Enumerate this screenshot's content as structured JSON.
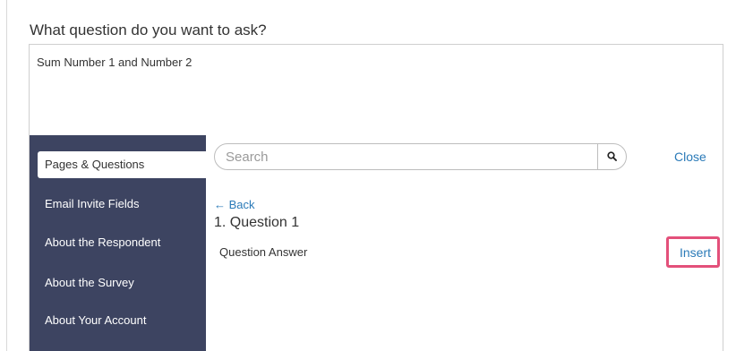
{
  "question": {
    "label": "What question do you want to ask?",
    "text": "Sum Number 1 and Number 2"
  },
  "sidebar": {
    "items": [
      {
        "label": "Pages & Questions",
        "active": true
      },
      {
        "label": "Email Invite Fields",
        "active": false
      },
      {
        "label": "About the Respondent",
        "active": false
      },
      {
        "label": "About the Survey",
        "active": false
      },
      {
        "label": "About Your Account",
        "active": false
      }
    ]
  },
  "search": {
    "placeholder": "Search",
    "value": "",
    "icon": "search-icon"
  },
  "close_label": "Close",
  "back_label": "← Back",
  "page_heading": "1. Question 1",
  "answer_label": "Question Answer",
  "insert_label": "Insert",
  "colors": {
    "sidebar_bg": "#3d4461",
    "link": "#2a7ab8",
    "highlight_border": "#e3507a"
  }
}
